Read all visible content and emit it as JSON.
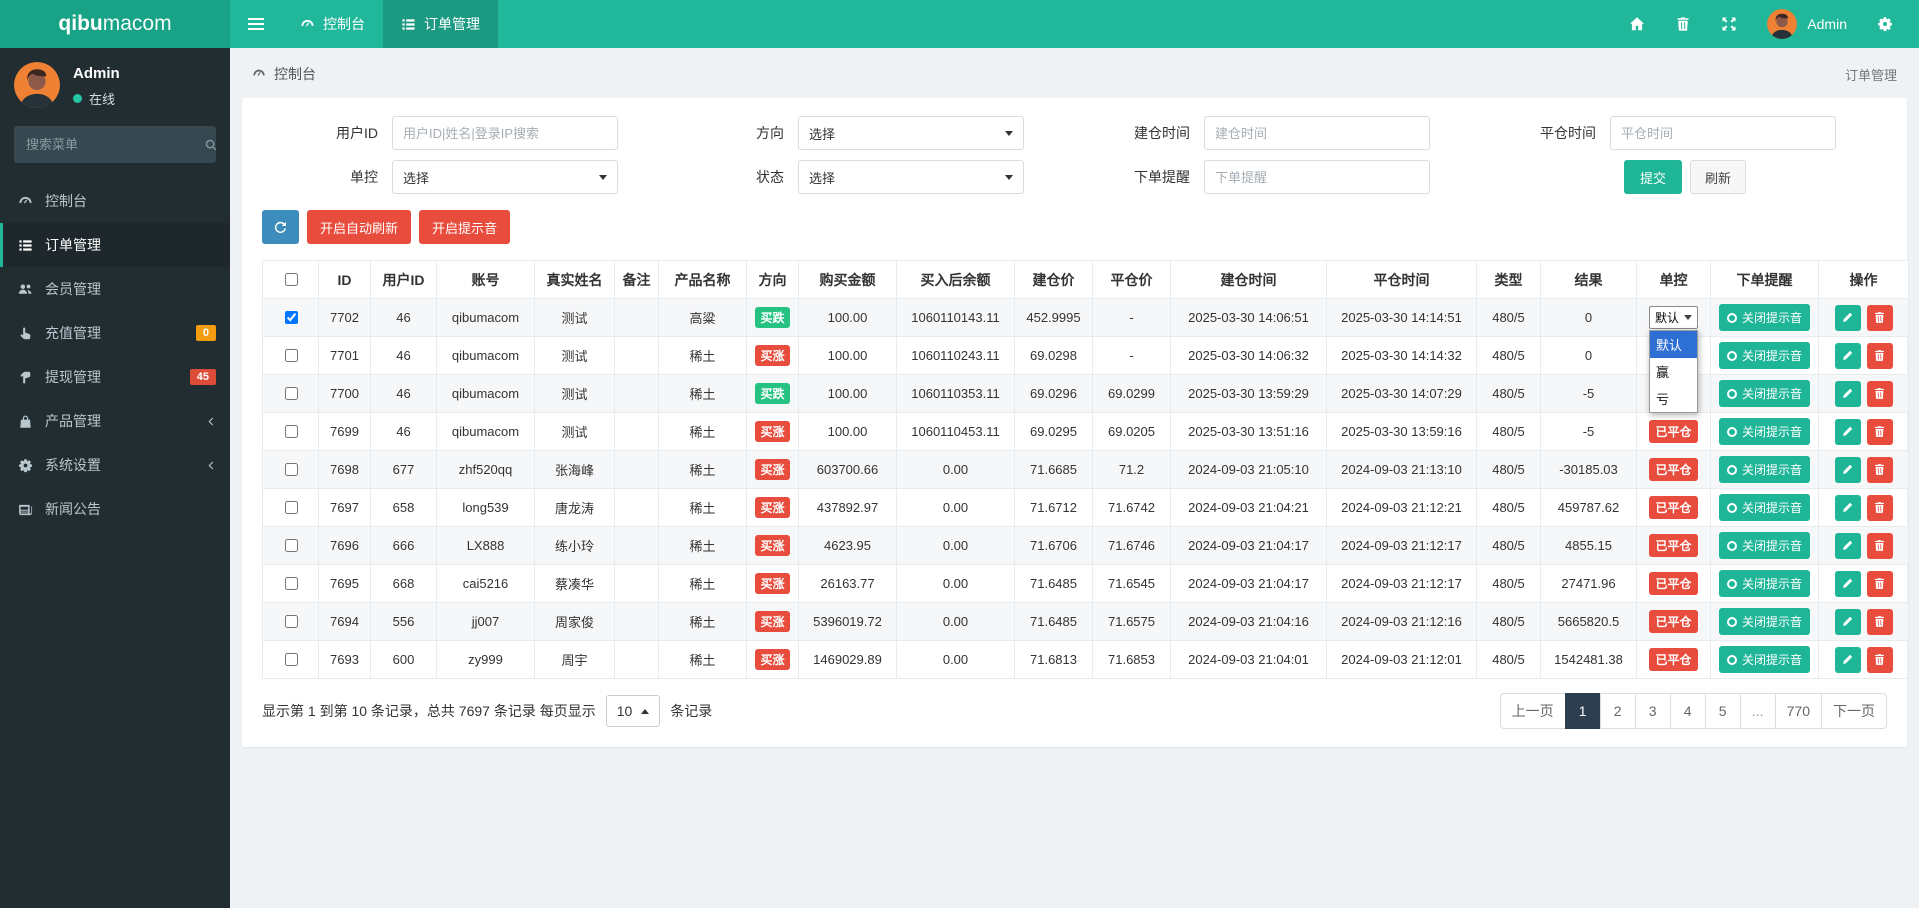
{
  "topbar": {
    "logo": {
      "bold": "qibu",
      "normal": "macom"
    },
    "tabs": [
      {
        "label": "控制台",
        "icon": "dashboard-icon",
        "active": false
      },
      {
        "label": "订单管理",
        "icon": "list-icon",
        "active": true
      }
    ],
    "user": {
      "name": "Admin"
    }
  },
  "sidebar": {
    "user": {
      "name": "Admin",
      "status": "在线"
    },
    "search_placeholder": "搜索菜单",
    "items": [
      {
        "label": "控制台",
        "icon": "dashboard-icon",
        "active": false
      },
      {
        "label": "订单管理",
        "icon": "list-icon",
        "active": true
      },
      {
        "label": "会员管理",
        "icon": "users-icon",
        "active": false
      },
      {
        "label": "充值管理",
        "icon": "hand-up-icon",
        "badge": "0",
        "badge_color": "#f39c12",
        "active": false
      },
      {
        "label": "提现管理",
        "icon": "hand-down-icon",
        "badge": "45",
        "badge_color": "#dd4b39",
        "active": false
      },
      {
        "label": "产品管理",
        "icon": "bag-icon",
        "chevron": true,
        "active": false
      },
      {
        "label": "系统设置",
        "icon": "cogs-icon",
        "chevron": true,
        "active": false
      },
      {
        "label": "新闻公告",
        "icon": "news-icon",
        "active": false
      }
    ]
  },
  "content_header": {
    "breadcrumb": "控制台",
    "right": "订单管理"
  },
  "filters": {
    "rows": [
      [
        {
          "label": "用户ID",
          "type": "input",
          "placeholder": "用户ID|姓名|登录IP搜索"
        },
        {
          "label": "方向",
          "type": "select",
          "value": "选择"
        },
        {
          "label": "建仓时间",
          "type": "input",
          "placeholder": "建仓时间"
        },
        {
          "label": "平仓时间",
          "type": "input",
          "placeholder": "平仓时间"
        }
      ],
      [
        {
          "label": "单控",
          "type": "select",
          "value": "选择"
        },
        {
          "label": "状态",
          "type": "select",
          "value": "选择"
        },
        {
          "label": "下单提醒",
          "type": "input",
          "placeholder": "下单提醒"
        },
        {
          "type": "buttons"
        }
      ]
    ],
    "submit_label": "提交",
    "refresh_label": "刷新"
  },
  "toolbar": {
    "auto_refresh_label": "开启自动刷新",
    "sound_label": "开启提示音"
  },
  "table": {
    "columns": [
      "",
      "ID",
      "用户ID",
      "账号",
      "真实姓名",
      "备注",
      "产品名称",
      "方向",
      "购买金额",
      "买入后余额",
      "建仓价",
      "平仓价",
      "建仓时间",
      "平仓时间",
      "类型",
      "结果",
      "单控",
      "下单提醒",
      "操作"
    ],
    "direction_colors": {
      "买涨": "#e74c3c",
      "买跌": "#26c281"
    },
    "closed_badge": "已平仓",
    "alert_button": "关闭提示音",
    "rows": [
      {
        "checked": true,
        "id": "7702",
        "uid": "46",
        "account": "qibumacom",
        "name": "测试",
        "remark": "",
        "product": "高粱",
        "direction": "买跌",
        "amount": "100.00",
        "balance": "1060110143.11",
        "open_price": "452.9995",
        "close_price": "-",
        "open_time": "2025-03-30 14:06:51",
        "close_time": "2025-03-30 14:14:51",
        "type": "480/5",
        "result": "0",
        "control": "select"
      },
      {
        "checked": false,
        "id": "7701",
        "uid": "46",
        "account": "qibumacom",
        "name": "测试",
        "remark": "",
        "product": "稀土",
        "direction": "买涨",
        "amount": "100.00",
        "balance": "1060110243.11",
        "open_price": "69.0298",
        "close_price": "-",
        "open_time": "2025-03-30 14:06:32",
        "close_time": "2025-03-30 14:14:32",
        "type": "480/5",
        "result": "0",
        "control": "none"
      },
      {
        "checked": false,
        "id": "7700",
        "uid": "46",
        "account": "qibumacom",
        "name": "测试",
        "remark": "",
        "product": "稀土",
        "direction": "买跌",
        "amount": "100.00",
        "balance": "1060110353.11",
        "open_price": "69.0296",
        "close_price": "69.0299",
        "open_time": "2025-03-30 13:59:29",
        "close_time": "2025-03-30 14:07:29",
        "type": "480/5",
        "result": "-5",
        "control": "none"
      },
      {
        "checked": false,
        "id": "7699",
        "uid": "46",
        "account": "qibumacom",
        "name": "测试",
        "remark": "",
        "product": "稀土",
        "direction": "买涨",
        "amount": "100.00",
        "balance": "1060110453.11",
        "open_price": "69.0295",
        "close_price": "69.0205",
        "open_time": "2025-03-30 13:51:16",
        "close_time": "2025-03-30 13:59:16",
        "type": "480/5",
        "result": "-5",
        "control": "closed"
      },
      {
        "checked": false,
        "id": "7698",
        "uid": "677",
        "account": "zhf520qq",
        "name": "张海峰",
        "remark": "",
        "product": "稀土",
        "direction": "买涨",
        "amount": "603700.66",
        "balance": "0.00",
        "open_price": "71.6685",
        "close_price": "71.2",
        "open_time": "2024-09-03 21:05:10",
        "close_time": "2024-09-03 21:13:10",
        "type": "480/5",
        "result": "-30185.03",
        "control": "closed"
      },
      {
        "checked": false,
        "id": "7697",
        "uid": "658",
        "account": "long539",
        "name": "唐龙涛",
        "remark": "",
        "product": "稀土",
        "direction": "买涨",
        "amount": "437892.97",
        "balance": "0.00",
        "open_price": "71.6712",
        "close_price": "71.6742",
        "open_time": "2024-09-03 21:04:21",
        "close_time": "2024-09-03 21:12:21",
        "type": "480/5",
        "result": "459787.62",
        "control": "closed"
      },
      {
        "checked": false,
        "id": "7696",
        "uid": "666",
        "account": "LX888",
        "name": "练小玲",
        "remark": "",
        "product": "稀土",
        "direction": "买涨",
        "amount": "4623.95",
        "balance": "0.00",
        "open_price": "71.6706",
        "close_price": "71.6746",
        "open_time": "2024-09-03 21:04:17",
        "close_time": "2024-09-03 21:12:17",
        "type": "480/5",
        "result": "4855.15",
        "control": "closed"
      },
      {
        "checked": false,
        "id": "7695",
        "uid": "668",
        "account": "cai5216",
        "name": "蔡凑华",
        "remark": "",
        "product": "稀土",
        "direction": "买涨",
        "amount": "26163.77",
        "balance": "0.00",
        "open_price": "71.6485",
        "close_price": "71.6545",
        "open_time": "2024-09-03 21:04:17",
        "close_time": "2024-09-03 21:12:17",
        "type": "480/5",
        "result": "27471.96",
        "control": "closed"
      },
      {
        "checked": false,
        "id": "7694",
        "uid": "556",
        "account": "jj007",
        "name": "周家俊",
        "remark": "",
        "product": "稀土",
        "direction": "买涨",
        "amount": "5396019.72",
        "balance": "0.00",
        "open_price": "71.6485",
        "close_price": "71.6575",
        "open_time": "2024-09-03 21:04:16",
        "close_time": "2024-09-03 21:12:16",
        "type": "480/5",
        "result": "5665820.5",
        "control": "closed"
      },
      {
        "checked": false,
        "id": "7693",
        "uid": "600",
        "account": "zy999",
        "name": "周宇",
        "remark": "",
        "product": "稀土",
        "direction": "买涨",
        "amount": "1469029.89",
        "balance": "0.00",
        "open_price": "71.6813",
        "close_price": "71.6853",
        "open_time": "2024-09-03 21:04:01",
        "close_time": "2024-09-03 21:12:01",
        "type": "480/5",
        "result": "1542481.38",
        "control": "closed"
      }
    ]
  },
  "control_dropdown": {
    "visible_value": "默认",
    "selected": "默认",
    "items": [
      "默认",
      "赢",
      "亏"
    ]
  },
  "pagination": {
    "info_prefix": "显示第 1 到第 10 条记录，总共 7697 条记录 每页显示",
    "page_size": "10",
    "info_suffix": "条记录",
    "pages": [
      "上一页",
      "1",
      "2",
      "3",
      "4",
      "5",
      "...",
      "770",
      "下一页"
    ],
    "active": "1"
  },
  "colors": {
    "topbar": "#21b79a",
    "sidebar": "#222d32",
    "accent": "#1fb698",
    "danger": "#e74c3c",
    "warning": "#f39c12",
    "info_blue": "#3c8dbc",
    "buy_up": "#e74c3c",
    "buy_down": "#26c281",
    "page_active": "#2c3e50",
    "dropdown_highlight": "#2e6fd6"
  }
}
